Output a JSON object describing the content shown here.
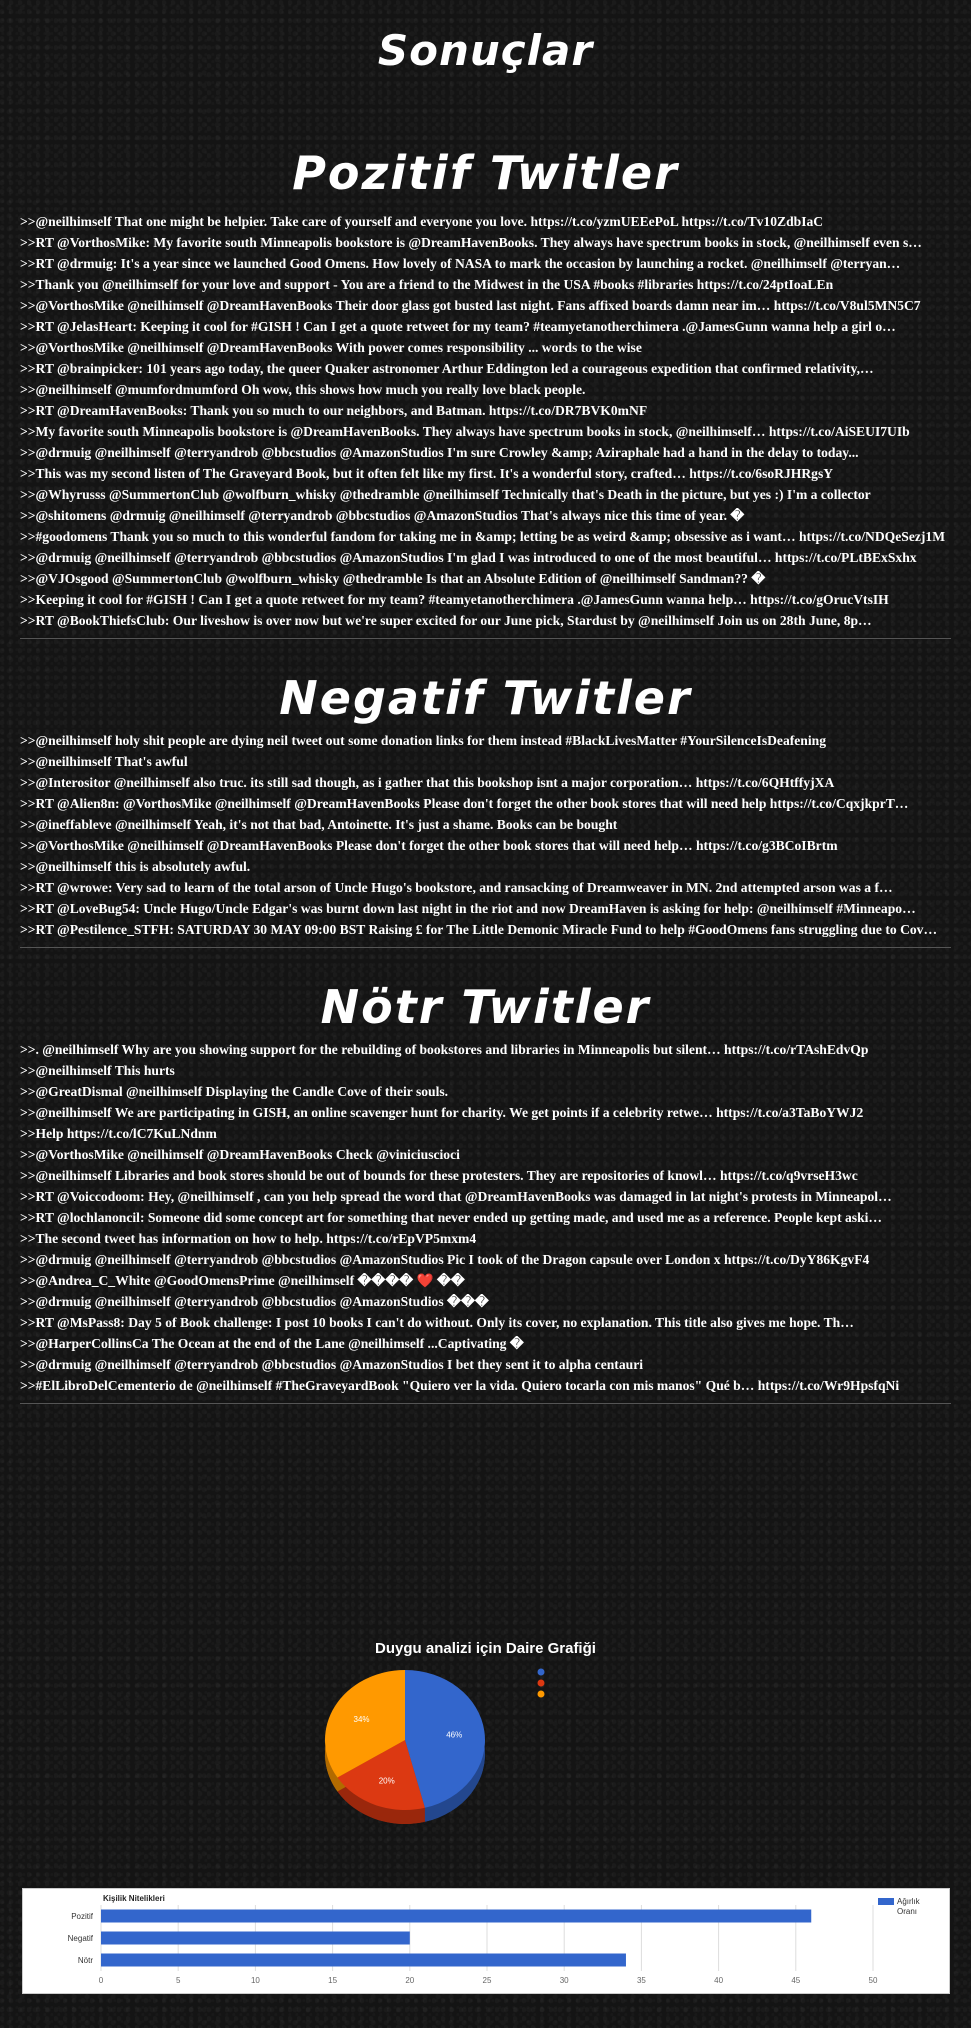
{
  "page_title": "Sonuçlar",
  "positive": {
    "title": "Pozitif Twitler",
    "tweets": [
      ">>@neilhimself That one might be helpier. Take care of yourself and everyone you love. https://t.co/yzmUEEePoL https://t.co/Tv10ZdbIaC",
      ">>RT @VorthosMike: My favorite south Minneapolis bookstore is @DreamHavenBooks. They always have spectrum books in stock, @neilhimself even s…",
      ">>RT @drmuig: It's a year since we launched Good Omens. How lovely of NASA to mark the occasion by launching a rocket. @neilhimself @terryan…",
      ">>Thank you @neilhimself for your love and support - You are a friend to the Midwest in the USA #books #libraries https://t.co/24ptIoaLEn",
      ">>@VorthosMike @neilhimself @DreamHavenBooks Their door glass got busted last night. Fans affixed boards damn near im… https://t.co/V8ul5MN5C7",
      ">>RT @JelasHeart: Keeping it cool for #GISH ! Can I get a quote retweet for my team? #teamyetanotherchimera .@JamesGunn wanna help a girl o…",
      ">>@VorthosMike @neilhimself @DreamHavenBooks With power comes responsibility ... words to the wise",
      ">>RT @brainpicker: 101 years ago today, the queer Quaker astronomer Arthur Eddington led a courageous expedition that confirmed relativity,…",
      ">>@neilhimself @mumfordmumford Oh wow, this shows how much you really love black people.",
      ">>RT @DreamHavenBooks: Thank you so much to our neighbors, and Batman. https://t.co/DR7BVK0mNF",
      ">>My favorite south Minneapolis bookstore is @DreamHavenBooks. They always have spectrum books in stock, @neilhimself… https://t.co/AiSEUI7UIb",
      ">>@drmuig @neilhimself @terryandrob @bbcstudios @AmazonStudios I'm sure Crowley &amp; Aziraphale had a hand in the delay to today...",
      ">>This was my second listen of The Graveyard Book, but it often felt like my first. It's a wonderful story, crafted… https://t.co/6soRJHRgsY",
      ">>@Whyrusss @SummertonClub @wolfburn_whisky @thedramble @neilhimself Technically that's Death in the picture, but yes :) I'm a collector",
      ">>@shitomens @drmuig @neilhimself @terryandrob @bbcstudios @AmazonStudios That's always nice this time of year. �",
      ">>#goodomens Thank you so much to this wonderful fandom for taking me in &amp; letting be as weird &amp; obsessive as i want… https://t.co/NDQeSezj1M",
      ">>@drmuig @neilhimself @terryandrob @bbcstudios @AmazonStudios I'm glad I was introduced to one of the most beautiful… https://t.co/PLtBExSxhx",
      ">>@VJOsgood @SummertonClub @wolfburn_whisky @thedramble Is that an Absolute Edition of @neilhimself Sandman?? �",
      ">>Keeping it cool for #GISH ! Can I get a quote retweet for my team? #teamyetanotherchimera .@JamesGunn wanna help… https://t.co/gOrucVtsIH",
      ">>RT @BookThiefsClub: Our liveshow is over now but we're super excited for our June pick, Stardust by @neilhimself Join us on 28th June, 8p…"
    ]
  },
  "negative": {
    "title": "Negatif Twitler",
    "tweets": [
      ">>@neilhimself holy shit people are dying neil tweet out some donation links for them instead #BlackLivesMatter #YourSilenceIsDeafening",
      ">>@neilhimself That's awful",
      ">>@Interositor @neilhimself also truc. its still sad though, as i gather that this bookshop isnt a major corporation… https://t.co/6QHtffyjXA",
      ">>RT @Alien8n: @VorthosMike @neilhimself @DreamHavenBooks Please don't forget the other book stores that will need help https://t.co/CqxjkprT…",
      ">>@ineffableve @neilhimself Yeah, it's not that bad, Antoinette. It's just a shame. Books can be bought",
      ">>@VorthosMike @neilhimself @DreamHavenBooks Please don't forget the other book stores that will need help… https://t.co/g3BCoIBrtm",
      ">>@neilhimself this is absolutely awful.",
      ">>RT @wrowe: Very sad to learn of the total arson of Uncle Hugo's bookstore, and ransacking of Dreamweaver in MN. 2nd attempted arson was a f…",
      ">>RT @LoveBug54: Uncle Hugo/Uncle Edgar's was burnt down last night in the riot and now DreamHaven is asking for help: @neilhimself #Minneapo…",
      ">>RT @Pestilence_STFH: SATURDAY 30 MAY 09:00 BST Raising £ for The Little Demonic Miracle Fund to help #GoodOmens fans struggling due to Cov…"
    ]
  },
  "neutral": {
    "title": "Nötr Twitler",
    "tweets": [
      ">>. @neilhimself Why are you showing support for the rebuilding of bookstores and libraries in Minneapolis but silent… https://t.co/rTAshEdvQp",
      ">>@neilhimself This hurts",
      ">>@GreatDismal @neilhimself Displaying the Candle Cove of their souls.",
      ">>@neilhimself We are participating in GISH, an online scavenger hunt for charity. We get points if a celebrity retwe… https://t.co/a3TaBoYWJ2",
      ">>Help https://t.co/lC7KuLNdnm",
      ">>@VorthosMike @neilhimself @DreamHavenBooks Check @viniciuscioci",
      ">>@neilhimself Libraries and book stores should be out of bounds for these protesters. They are repositories of knowl… https://t.co/q9vrseH3wc",
      ">>RT @Voiccodoom: Hey, @neilhimself , can you help spread the word that @DreamHavenBooks was damaged in lat night's protests in Minneapol…",
      ">>RT @lochlanoncil: Someone did some concept art for something that never ended up getting made, and used me as a reference. People kept aski…",
      ">>The second tweet has information on how to help. https://t.co/rEpVP5mxm4",
      ">>@drmuig @neilhimself @terryandrob @bbcstudios @AmazonStudios Pic I took of the Dragon capsule over London x https://t.co/DyY86KgvF4",
      ">>@Andrea_C_White @GoodOmensPrime @neilhimself ���� ❤️ ��",
      ">>@drmuig @neilhimself @terryandrob @bbcstudios @AmazonStudios ���",
      ">>RT @MsPass8: Day 5 of Book challenge: I post 10 books I can't do without. Only its cover, no explanation. This title also gives me hope. Th…",
      ">>@HarperCollinsCa The Ocean at the end of the Lane @neilhimself ...Captivating �",
      ">>@drmuig @neilhimself @terryandrob @bbcstudios @AmazonStudios I bet they sent it to alpha centauri",
      ">>#ElLibroDelCementerio de @neilhimself #TheGraveyardBook \"Quiero ver la vida. Quiero tocarla con mis manos\" Qué b… https://t.co/Wr9HpsfqNi"
    ]
  },
  "chart_data": [
    {
      "type": "pie",
      "title": "Duygu analizi için Daire Grafiği",
      "slices": [
        {
          "label": "",
          "value": 46,
          "label_text": "46%",
          "color": "#3366cc"
        },
        {
          "label": "",
          "value": 20,
          "label_text": "20%",
          "color": "#dc3912"
        },
        {
          "label": "",
          "value": 34,
          "label_text": "34%",
          "color": "#ff9900"
        }
      ],
      "legend_colors": [
        "#3366cc",
        "#dc3912",
        "#ff9900"
      ],
      "legend_position": "right",
      "style": "3d"
    },
    {
      "type": "bar",
      "orientation": "horizontal",
      "title": "Kişilik Nitelikleri",
      "categories": [
        "Pozitif",
        "Negatif",
        "Nötr"
      ],
      "series": [
        {
          "name": "Ağırlık Oranı",
          "values": [
            46,
            20,
            34
          ],
          "color": "#3366cc"
        }
      ],
      "xlim": [
        0,
        50
      ],
      "ticks": [
        0,
        5,
        10,
        15,
        20,
        25,
        30,
        35,
        40,
        45,
        50
      ],
      "legend_position": "right",
      "grid": true
    }
  ]
}
